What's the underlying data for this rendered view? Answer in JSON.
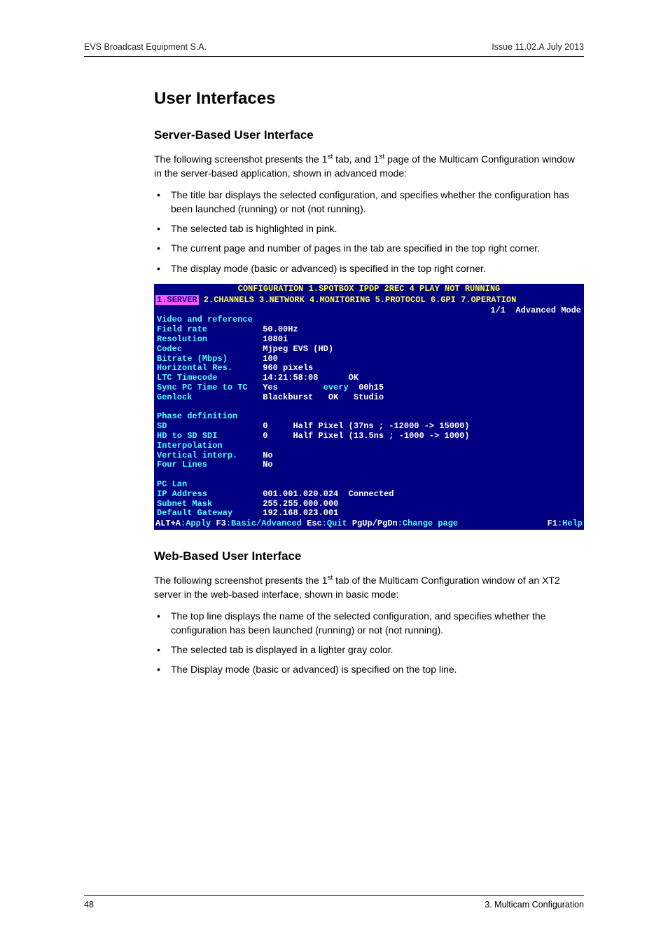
{
  "header": {
    "left": "EVS Broadcast Equipment S.A.",
    "right": "Issue 11.02.A  July 2013"
  },
  "title": "User Interfaces",
  "section1": {
    "heading": "Server-Based User Interface",
    "intro_pre": "The following screenshot presents the 1",
    "intro_mid": " tab, and 1",
    "intro_post": " page of the Multicam Configuration window in the server-based application, shown in advanced mode:",
    "sup": "st",
    "bullets": [
      "The title bar displays the selected configuration, and specifies whether the configuration has been launched (running) or not (not running).",
      "The selected tab is highlighted in pink.",
      "The current page and number of pages in the tab are specified in the top right corner.",
      "The display mode (basic or advanced) is specified in the top right corner."
    ]
  },
  "terminal": {
    "title": "CONFIGURATION  1.SPOTBOX IPDP 2REC 4 PLAY NOT RUNNING",
    "tab_selected": "1.SERVER",
    "tabs_rest": " 2.CHANNELS 3.NETWORK 4.MONITORING 5.PROTOCOL 6.GPI 7.OPERATION",
    "mode": "1/1  Advanced Mode",
    "sections": {
      "video_ref": "Video and reference",
      "field_rate": {
        "label": "Field rate",
        "value": "50.00Hz"
      },
      "resolution": {
        "label": "Resolution",
        "value": "1080i"
      },
      "codec": {
        "label": "Codec",
        "value": "Mjpeg EVS (HD)"
      },
      "bitrate": {
        "label": "Bitrate (Mbps)",
        "value": "100"
      },
      "horiz": {
        "label": "Horizontal Res.",
        "value": "960 pixels"
      },
      "ltc": {
        "label": "LTC Timecode",
        "value": "14:21:58:08",
        "status": "OK"
      },
      "sync": {
        "label": "Sync PC Time to TC",
        "value": "Yes",
        "every": "every",
        "period": "00h15"
      },
      "genlock": {
        "label": "Genlock",
        "value": "Blackburst",
        "status": "OK",
        "mode": "Studio"
      },
      "phase": "Phase definition",
      "sd": {
        "label": "SD",
        "value": "0",
        "note": "Half Pixel (37ns ; -12000 -> 15000)"
      },
      "hd_sd": {
        "label": "HD to SD SDI",
        "value": "0",
        "note": "Half Pixel (13.5ns ; -1000 -> 1000)"
      },
      "interp": "Interpolation",
      "vert": {
        "label": "Vertical interp.",
        "value": "No"
      },
      "four": {
        "label": "Four Lines",
        "value": "No"
      },
      "pclan": "PC Lan",
      "ip": {
        "label": "IP Address",
        "value": "001.001.020.024",
        "status": "Connected"
      },
      "subnet": {
        "label": "Subnet Mask",
        "value": "255.255.000.000"
      },
      "gw": {
        "label": "Default Gateway",
        "value": "192.168.023.001"
      }
    },
    "footer": {
      "k1": "ALT+A",
      "a1": ":Apply ",
      "k2": "F3",
      "a2": ":Basic/Advanced ",
      "k3": "Esc",
      "a3": ":Quit ",
      "k4": "PgUp/PgDn",
      "a4": ":Change page",
      "k5": "F1",
      "a5": ":Help"
    }
  },
  "section2": {
    "heading": "Web-Based User Interface",
    "intro_pre": "The following screenshot presents the 1",
    "intro_post": " tab of the Multicam Configuration window of an XT2 server in the web-based interface, shown in basic mode:",
    "sup": "st",
    "bullets": [
      "The top line displays the name of the selected configuration, and specifies whether the configuration has been launched (running) or not (not running).",
      "The selected tab is displayed in a lighter gray color.",
      "The Display mode (basic or advanced) is specified on the top line."
    ]
  },
  "footer": {
    "left": "48",
    "right": "3. Multicam Configuration"
  }
}
